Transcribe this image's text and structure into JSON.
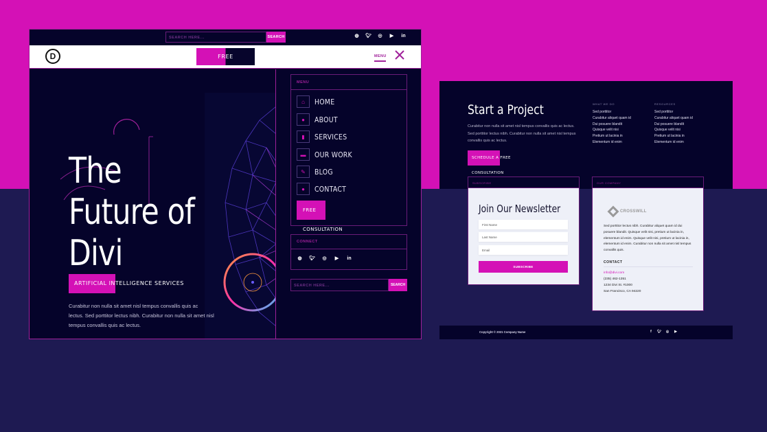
{
  "colors": {
    "accent": "#d411b6",
    "navy_dark": "#05032a",
    "navy_mid": "#1e1a52",
    "card_bg": "#eef0f8"
  },
  "left_mockup": {
    "topbar": {
      "search_placeholder": "SEARCH HERE...",
      "search_button": "SEARCH",
      "social_icons": [
        "dribbble-icon",
        "twitter-icon",
        "instagram-icon",
        "youtube-icon",
        "linkedin-icon"
      ]
    },
    "header": {
      "logo": "D",
      "cta": "FREE CONSULTATION",
      "menu_label": "MENU"
    },
    "hero": {
      "title_line1": "The",
      "title_line2": "Future of",
      "title_line3": "Divi",
      "badge": "ARTIFICIAL INTELLIGENCE SERVICES",
      "body": "Curabitur non nulla sit amet nisl tempus convallis quis ac lectus. Sed porttitor lectus nibh. Curabitur non nulla sit amet nisl tempus convallis quis ac lectus."
    },
    "menu_panel": {
      "heading": "MENU",
      "items": [
        {
          "label": "HOME",
          "icon": "home-icon",
          "glyph": "⌂"
        },
        {
          "label": "ABOUT",
          "icon": "robot-icon",
          "glyph": "●"
        },
        {
          "label": "SERVICES",
          "icon": "mobile-icon",
          "glyph": "▮"
        },
        {
          "label": "OUR WORK",
          "icon": "briefcase-icon",
          "glyph": "▬"
        },
        {
          "label": "BLOG",
          "icon": "edit-icon",
          "glyph": "✎"
        },
        {
          "label": "CONTACT",
          "icon": "chat-icon",
          "glyph": "●"
        }
      ],
      "cta": "FREE CONSULTATION",
      "connect_heading": "CONNECT",
      "search_placeholder": "SEARCH HERE...",
      "search_button": "SEARCH"
    }
  },
  "right_mockup": {
    "title": "Start a Project",
    "body": "Curabitur non nulla sit amet nisl tempus convallis quis ac lectus. Sed porttitor lectus nibh. Curabitur non nulla sit amet nisl tempus convallis quis ac lectus.",
    "cta": "SCHEDULE A FREE CONSULTATION",
    "columns": [
      {
        "heading": "WHAT WE DO",
        "items": [
          "Sed porttitor",
          "Curabitur aliquet quam id",
          "Dui posuere blandit",
          "Quisque velit nisi",
          "Pretium ut lacinia in",
          "Elementum id enim"
        ]
      },
      {
        "heading": "RESOURCES",
        "items": [
          "Sed porttitor",
          "Curabitur aliquet quam id",
          "Dui posuere blandit",
          "Quisque velit nisi",
          "Pretium ut lacinia in",
          "Elementum id enim"
        ]
      }
    ],
    "subscribe_card": {
      "heading": "SUBSCRIBE",
      "title": "Join Our Newsletter",
      "first_name_placeholder": "First Name",
      "last_name_placeholder": "Last Name",
      "email_placeholder": "Email",
      "button": "SUBSCRIBE"
    },
    "company_card": {
      "heading": "OUR COMPANY",
      "logo_text": "CROSSWILL",
      "body": "Sed porttitor lectus nibh. Curabitur aliquet quam id dui posuere blandit. Quisque velit nisi, pretium ut lacinia in, elementum id enim. Quisque velit nisi, pretium ut lacinia in, elementum id enim. Curabitur non nulla sit amet nisl tempus convallis quis.",
      "contact_heading": "CONTACT",
      "email": "info@divi.com",
      "phone": "(235) 462-1351",
      "address1": "1234 Divi St. #1000",
      "address2": "San Francisco, CA 94220"
    },
    "footer": {
      "copyright": "Copyright © 2021 Company Name",
      "social_icons": [
        "facebook-icon",
        "twitter-icon",
        "instagram-icon",
        "youtube-icon"
      ]
    }
  }
}
